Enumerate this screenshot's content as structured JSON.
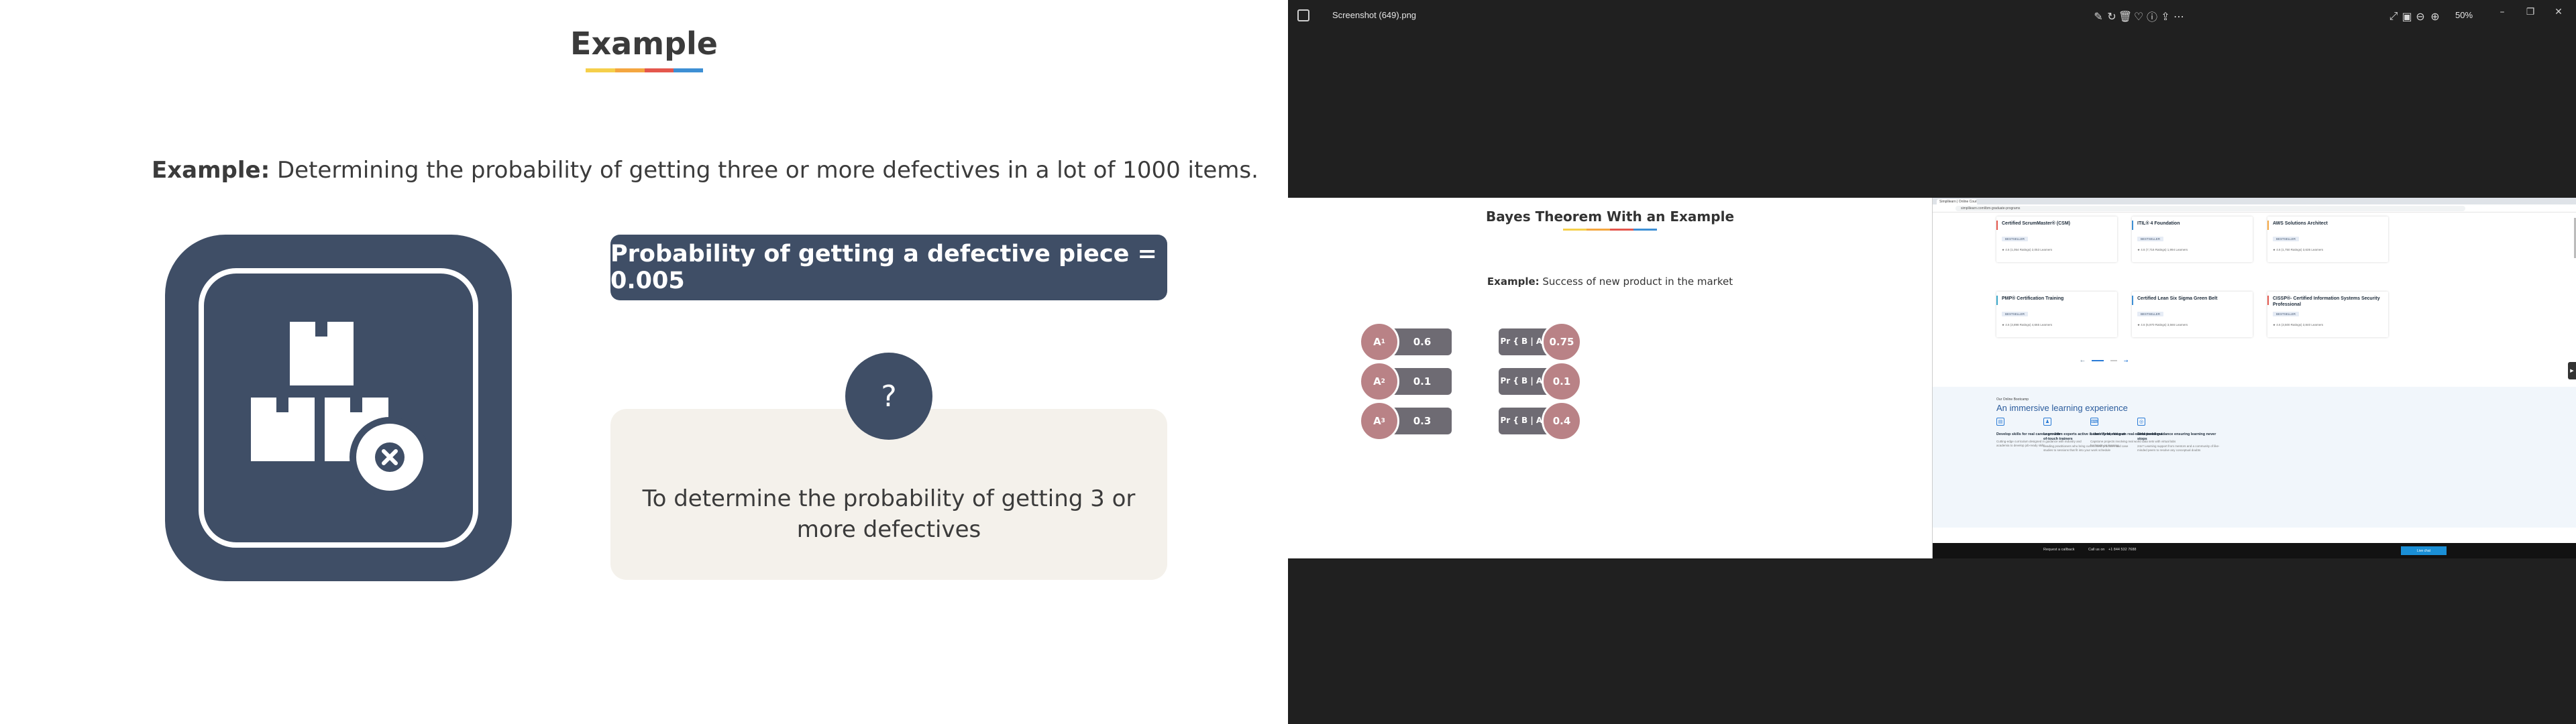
{
  "colors": {
    "slate": "#3f4e66",
    "cream": "#f4f1eb",
    "mauve": "#b98286",
    "accent_orange": "#f4a640",
    "accent_red": "#e4574d",
    "accent_blue": "#3d8fd4",
    "accent_yellow": "#f5cf4a"
  },
  "slide": {
    "title": "Example",
    "example_label": "Example:",
    "example_text": " Determining the probability of getting three or more defectives in a lot of 1000 items.",
    "icon": "box-defect-icon",
    "prob_box": "Probability of getting a defective piece = 0.005",
    "question_mark": "?",
    "note": "To determine the probability of getting 3 or more defectives"
  },
  "viewer": {
    "file_name": "Screenshot (649).png",
    "zoom": "50%",
    "toolbar_icons": [
      "edit-icon",
      "rotate-icon",
      "delete-icon",
      "favorite-icon",
      "info-icon",
      "share-icon",
      "more-icon"
    ],
    "right_icons": [
      "fullscreen-icon",
      "fit-icon",
      "zoom-out-icon",
      "zoom-in-icon"
    ],
    "window_controls": [
      "minimize-icon",
      "restore-icon",
      "close-icon"
    ],
    "window_glyphs": [
      "–",
      "❐",
      "✕"
    ]
  },
  "bayes": {
    "title": "Bayes Theorem With an Example",
    "example_label": "Example:",
    "example_text": " Success of new product in the market",
    "left": [
      {
        "label_main": "A",
        "label_sub": "1",
        "value": "0.6"
      },
      {
        "label_main": "A",
        "label_sub": "2",
        "value": "0.1"
      },
      {
        "label_main": "A",
        "label_sub": "3",
        "value": "0.3"
      }
    ],
    "right": [
      {
        "label_pre": "Pr { B | A",
        "label_sub": "1",
        "label_post": " }",
        "value": "0.75"
      },
      {
        "label_pre": "Pr { B | A",
        "label_sub": "2",
        "label_post": " }",
        "value": "0.1"
      },
      {
        "label_pre": "Pr { B | A",
        "label_sub": "3",
        "label_post": " }",
        "value": "0.4"
      }
    ]
  },
  "browser": {
    "tab_title": "Simplilearn | Online Courses",
    "url": "simplilearn.com/ibm-graduate-programs",
    "courses": [
      {
        "name": "Certified ScrumMaster® (CSM)",
        "tag": "BESTSELLER",
        "meta": "★ 4.6 (1,054 Ratings)   2,053 Learners",
        "color": "#e4574d"
      },
      {
        "name": "ITIL® 4 Foundation",
        "tag": "BESTSELLER",
        "meta": "★ 4.6 (7,716 Ratings)   1,994 Learners",
        "color": "#3d8fd4"
      },
      {
        "name": "AWS Solutions Architect",
        "tag": "BESTSELLER",
        "meta": "★ 4.6 (1,750 Ratings)   3,635 Learners",
        "color": "#f4a640"
      },
      {
        "name": "PMP® Certification Training",
        "tag": "BESTSELLER",
        "meta": "★ 4.6 (3,898 Ratings)   4,665 Learners",
        "color": "#3aa8c9"
      },
      {
        "name": "Certified Lean Six Sigma Green Belt",
        "tag": "BESTSELLER",
        "meta": "★ 4.6 (6,970 Ratings)   3,566 Learners",
        "color": "#3d8fd4"
      },
      {
        "name": "CISSP®- Certified Information Systems Security Professional",
        "tag": "BESTSELLER",
        "meta": "★ 4.6 (3,500 Ratings)   3,840 Learners",
        "color": "#e4574d"
      }
    ],
    "learn_kicker": "Our Online Bootcamp",
    "learn_heading": "An immersive learning experience",
    "features": [
      {
        "title": "Develop skills for real career growth",
        "desc": "Cutting-edge curriculum designed in guidance with industry and academia to develop job-ready skills",
        "icon": "▤"
      },
      {
        "title": "Learn from experts active in their field, not out-of-touch trainers",
        "desc": "Leading practitioners who bring current best practices and case studies to sessions that fit into your work schedule",
        "icon": "♟"
      },
      {
        "title": "Learn by working on real-world problems",
        "desc": "Capstone projects involving real world data sets with virtual labs for hands-on learning",
        "icon": "⌨"
      },
      {
        "title": "Structured guidance ensuring learning never stops",
        "desc": "24x7 Learning support from mentors and a community of like-minded peers to resolve any conceptual doubts",
        "icon": "◎"
      }
    ],
    "footer": {
      "callback": "Request a callback",
      "call": "Call us on",
      "phone": "+1 844 532 7688",
      "live": "Live chat"
    }
  }
}
